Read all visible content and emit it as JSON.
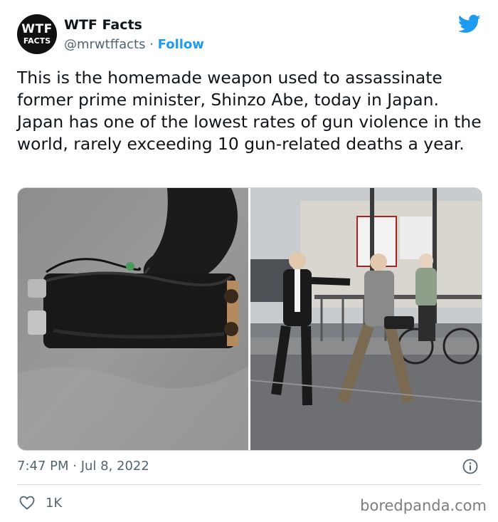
{
  "author": {
    "avatar_line1": "WTF",
    "avatar_line2": "FACTS",
    "display_name": "WTF Facts",
    "handle": "@mrwtffacts",
    "separator": " · ",
    "follow_label": "Follow"
  },
  "tweet": {
    "text": "This is the homemade weapon used to assassinate former prime minister, Shinzo Abe, today in Japan. Japan has one of the lowest rates of gun violence in the world, rarely exceeding 10 gun-related deaths a year.",
    "timestamp": "7:47 PM · Jul 8, 2022"
  },
  "media": {
    "left_photo": "homemade-weapon-photo",
    "right_photo": "arrest-scene-photo"
  },
  "engagement": {
    "likes": "1K"
  },
  "watermark": "boredpanda.com",
  "colors": {
    "accent": "#1d9bf0",
    "text": "#0f1419",
    "secondary": "#536471",
    "divider": "#cfd9de"
  },
  "icons": [
    "twitter-bird-icon",
    "info-icon",
    "heart-icon"
  ]
}
